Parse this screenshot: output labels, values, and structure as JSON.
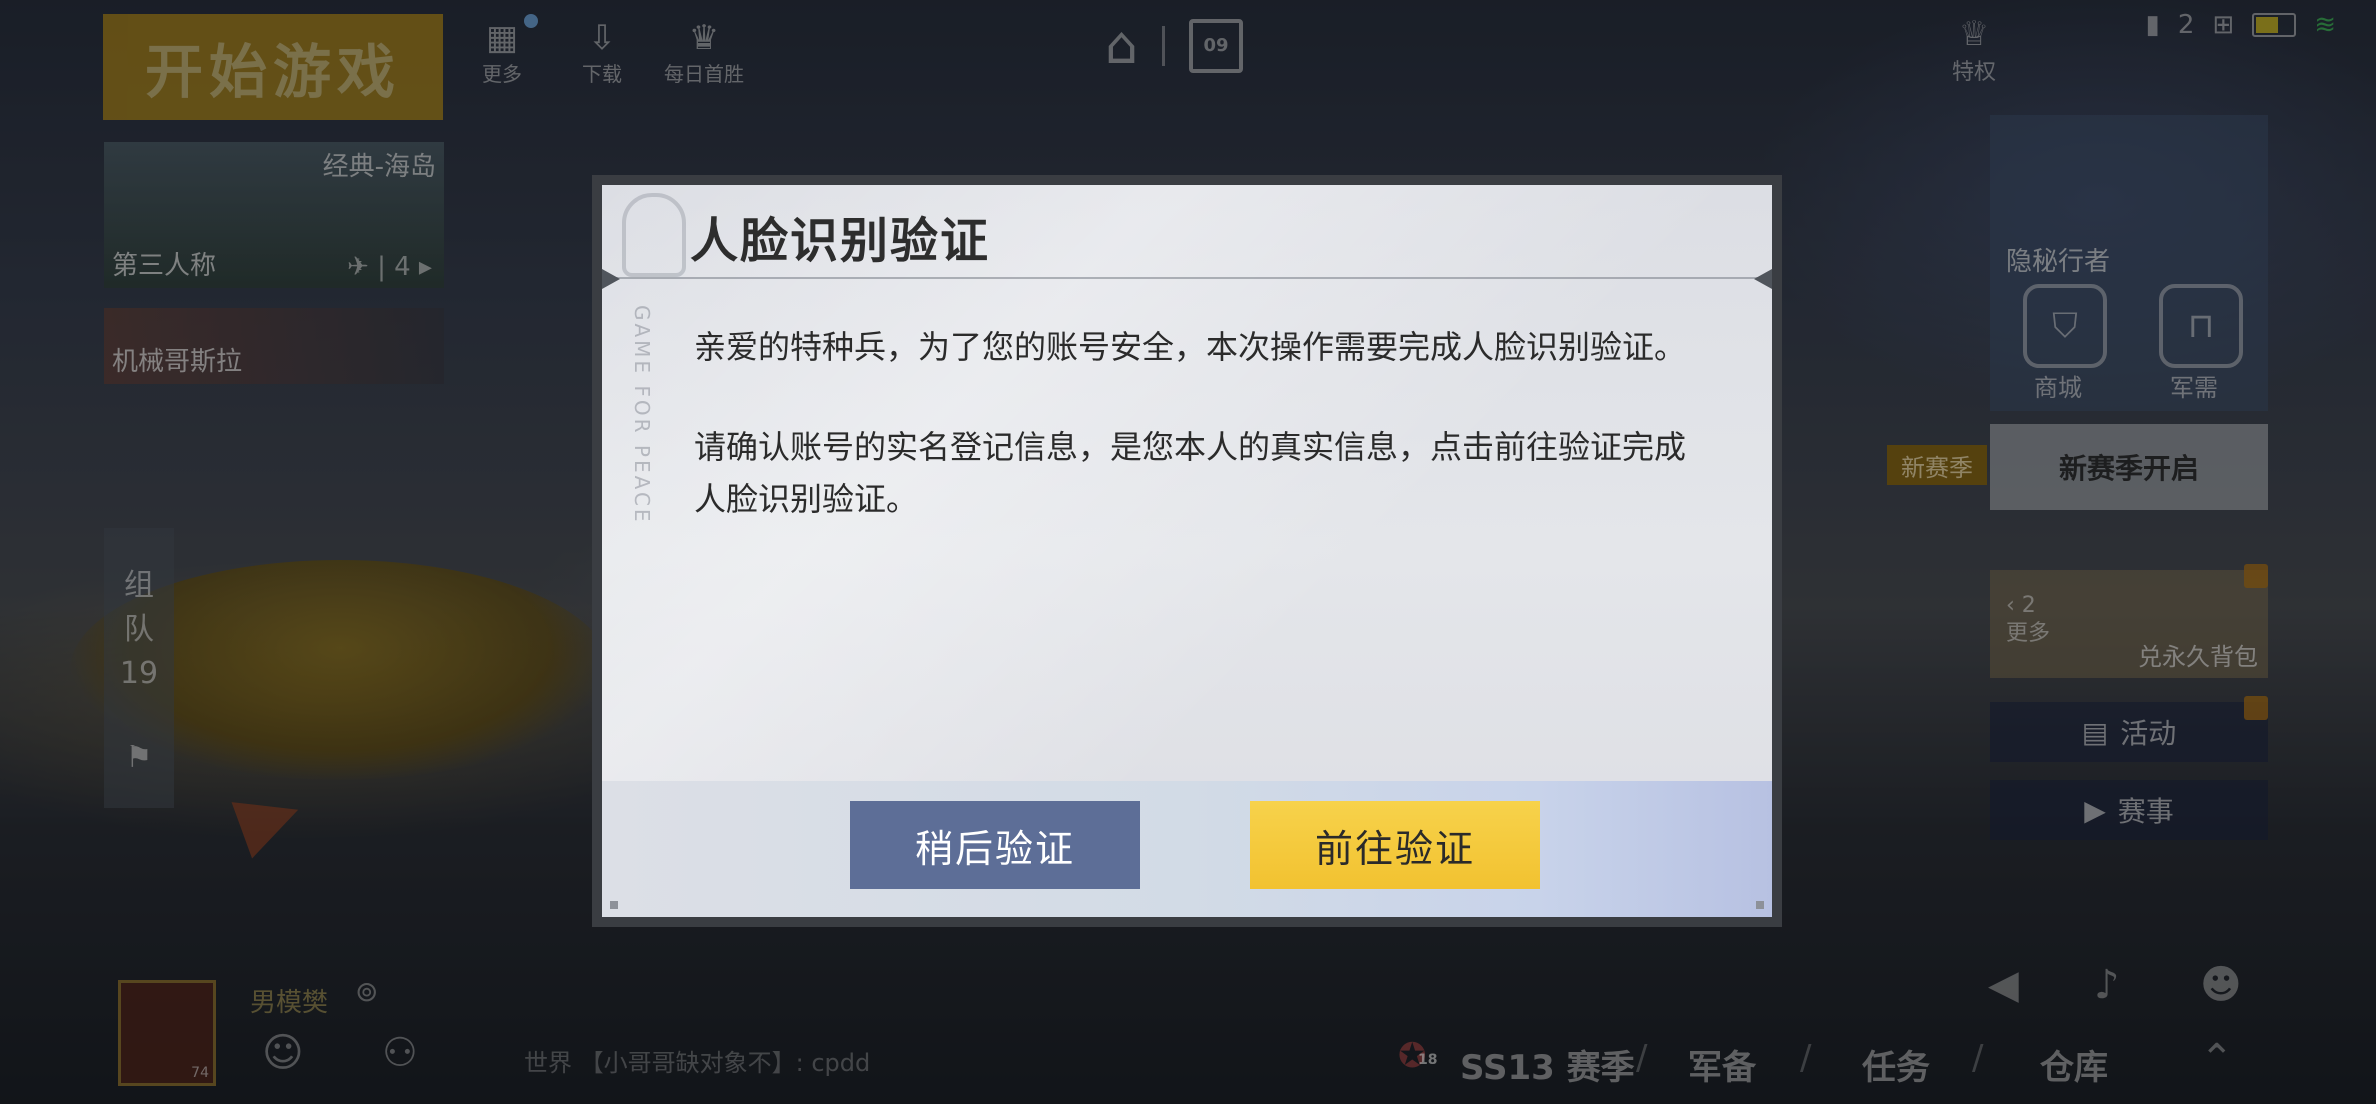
{
  "top": {
    "start_button": "开始游戏",
    "icons": [
      {
        "label": "更多",
        "icon": "more-icon"
      },
      {
        "label": "下载",
        "icon": "download-icon"
      },
      {
        "label": "每日首胜",
        "icon": "trophy-icon"
      }
    ],
    "calendar_day": "09",
    "privilege_label": "特权",
    "status_count": "2"
  },
  "map_cards": [
    {
      "tag": "经典-海岛",
      "name": "第三人称",
      "squad": "4"
    },
    {
      "name": "机械哥斯拉"
    }
  ],
  "team_panel": {
    "label_1": "组",
    "label_2": "队",
    "count": "19"
  },
  "right_panel": {
    "banner_title": "隐秘行者",
    "shop_label": "商城",
    "military_label": "军需",
    "season_tag": "新赛季",
    "season_box": "新赛季开启",
    "promo_page": "2",
    "promo_more": "更多",
    "promo_label": "兑永久背包",
    "activity_label": "活动",
    "event_label": "赛事"
  },
  "bottom": {
    "player_name": "男模樊",
    "avatar_level": "74",
    "chat_line": "世界 【小哥哥缺对象不】: cpdd",
    "season_badge": "18",
    "season_label": "SS13 赛季",
    "nav_gear": "军备",
    "nav_task": "任务",
    "nav_storage": "仓库"
  },
  "dialog": {
    "title": "人脸识别验证",
    "watermark": "GAME FOR PEACE",
    "paragraph_1": "亲爱的特种兵，为了您的账号安全，本次操作需要完成人脸识别验证。",
    "paragraph_2": "请确认账号的实名登记信息，是您本人的真实信息，点击前往验证完成人脸识别验证。",
    "later_button": "稍后验证",
    "go_button": "前往验证"
  },
  "colors": {
    "go_button": "#f2c230",
    "later_button": "#5d6e97",
    "start_button": "#c79a1c"
  }
}
